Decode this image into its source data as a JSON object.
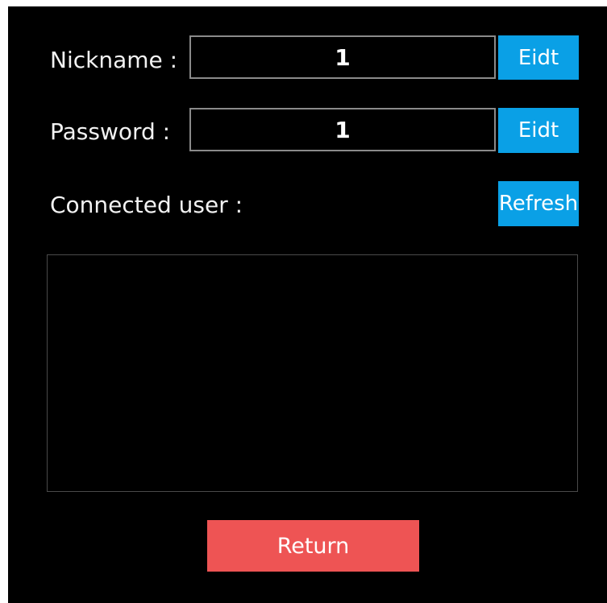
{
  "nickname": {
    "label": "Nickname :",
    "value": "1",
    "edit_label": "Eidt"
  },
  "password": {
    "label": "Password :",
    "value": "1",
    "edit_label": "Eidt"
  },
  "connected": {
    "label": "Connected user :",
    "refresh_label": "Refresh",
    "users": []
  },
  "footer": {
    "return_label": "Return"
  },
  "colors": {
    "background": "#000000",
    "button_blue": "#0aa0e6",
    "button_red": "#ee5454",
    "field_border": "#8a8a8a"
  }
}
